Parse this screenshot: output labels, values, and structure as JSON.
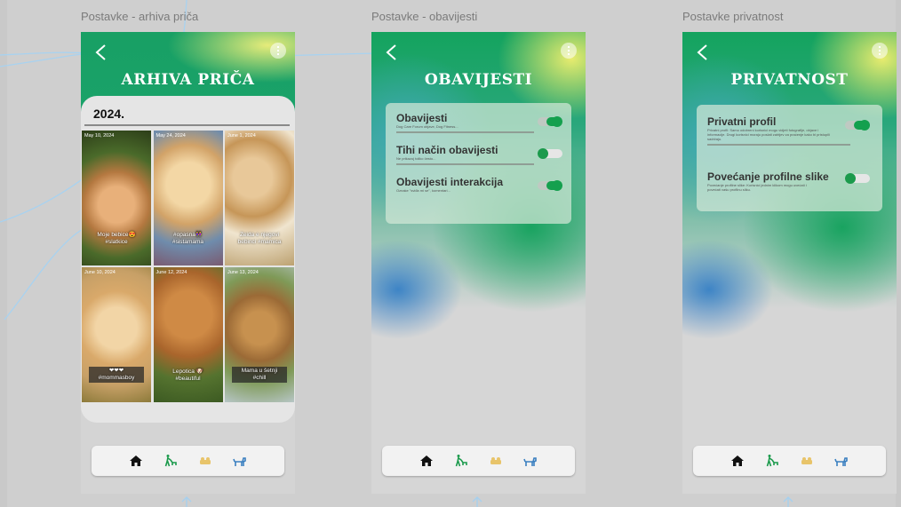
{
  "frames": {
    "archive": {
      "label": "Postavke - arhiva priča",
      "title": "ARHIVA PRIČA",
      "year": "2024.",
      "stories": [
        {
          "date": "May 10, 2024",
          "caption": "Moje bebice😍 #slatkice"
        },
        {
          "date": "May 24, 2024",
          "caption": "#opasna👭 #sistamama"
        },
        {
          "date": "June 1, 2024",
          "caption": "Zeida e njegovi bebinci #mamica"
        },
        {
          "date": "June 10, 2024",
          "caption": "❤❤❤ #mommasboy"
        },
        {
          "date": "June 12, 2024",
          "caption": "Lepotica 🐶 #beautiful"
        },
        {
          "date": "June 13, 2024",
          "caption": "Mama u šetnji #chill"
        }
      ]
    },
    "notifications": {
      "label": "Postavke - obavijesti",
      "title": "OBAVIJESTI",
      "settings": [
        {
          "title": "Obavijesti",
          "desc": "Dog Care Forum objave, Dog Fitness...",
          "state": "on"
        },
        {
          "title": "Tihi način obavijesti",
          "desc": "Ne prikazuj toliko često...",
          "state": "off"
        },
        {
          "title": "Obavijesti interakcija",
          "desc": "Oznake \"sviđa mi se\", komentari...",
          "state": "on"
        }
      ]
    },
    "privacy": {
      "label": "Postavke privatnost",
      "title": "PRIVATNOST",
      "settings": [
        {
          "title": "Privatni profil",
          "desc": "Privatni profil: Samo odobreni korisnici mogu vidjeti fotografije, objave i informacije. Drugi korisnici moraju poslati zahtjev za praćenje kako bi pristupili sadržaju.",
          "state": "on"
        },
        {
          "title": "Povećanje profilne slike",
          "desc": "Povećanje profilne slike: Korisnici jednim klikom mogu uvećati i povećati vašu profilnu sliku.",
          "state": "off"
        }
      ]
    }
  },
  "nav_items": [
    "home-icon",
    "dog-walk-icon",
    "dog-bed-icon",
    "dog-icon"
  ],
  "colors": {
    "accent_green": "#14a04e",
    "header_green": "#18a064",
    "nav_home": "#111111",
    "nav_walk": "#1b9a4c",
    "nav_bed": "#e8c46a",
    "nav_dog": "#3a7fc0"
  }
}
